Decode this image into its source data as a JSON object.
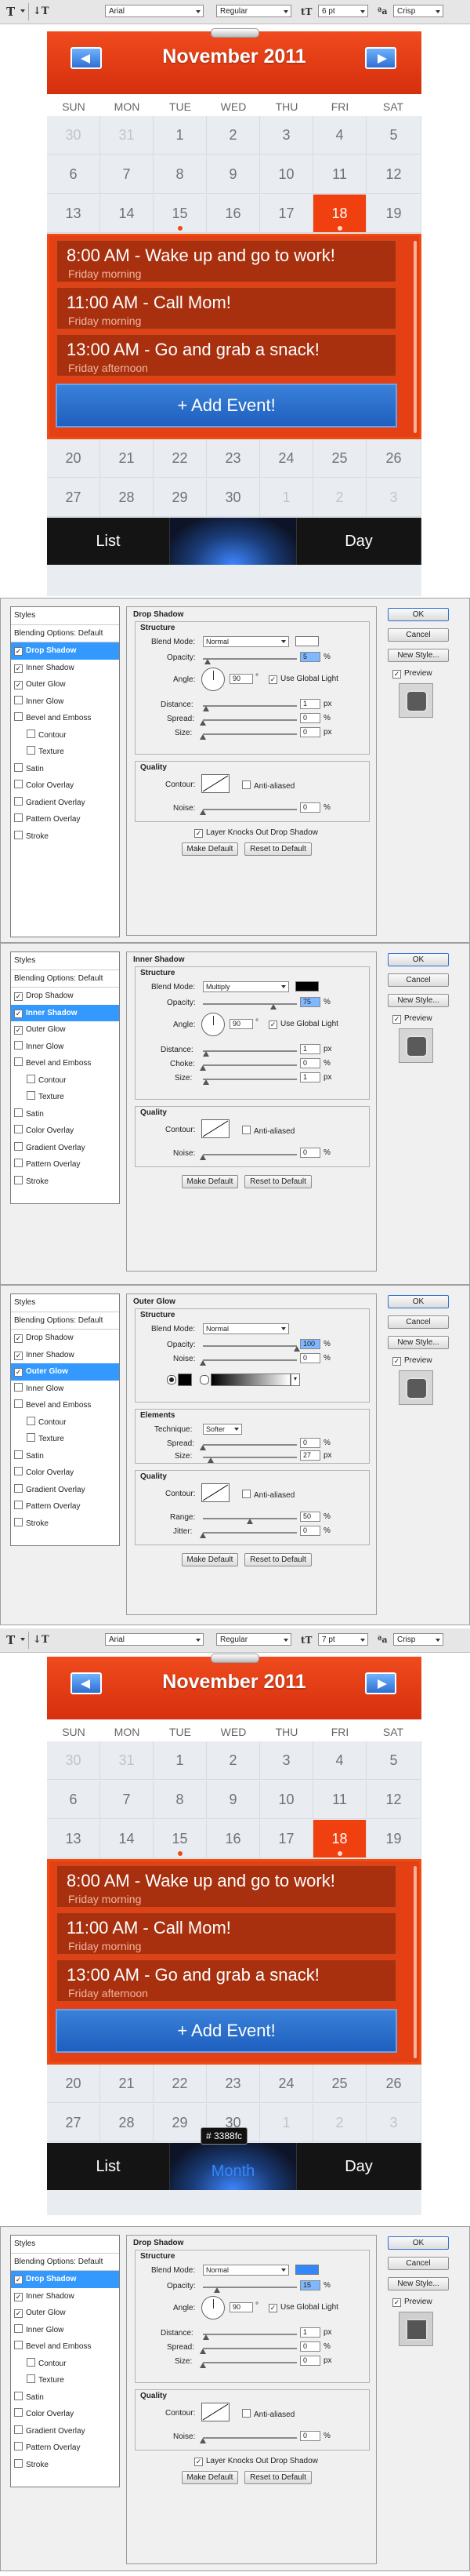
{
  "toolbars": [
    {
      "font_family": "Arial",
      "font_style": "Regular",
      "font_size": "6 pt",
      "antialias": "Crisp"
    },
    {
      "font_family": "Arial",
      "font_style": "Regular",
      "font_size": "7 pt",
      "antialias": "Crisp"
    }
  ],
  "calendar": {
    "title": "November 2011",
    "days_of_week": [
      "SUN",
      "MON",
      "TUE",
      "WED",
      "THU",
      "FRI",
      "SAT"
    ],
    "weeks_top": [
      [
        "30",
        "31",
        "1",
        "2",
        "3",
        "4",
        "5"
      ],
      [
        "6",
        "7",
        "8",
        "9",
        "10",
        "11",
        "12"
      ],
      [
        "13",
        "14",
        "15",
        "16",
        "17",
        "18",
        "19"
      ]
    ],
    "weeks_bottom": [
      [
        "20",
        "21",
        "22",
        "23",
        "24",
        "25",
        "26"
      ],
      [
        "27",
        "28",
        "29",
        "30",
        "1",
        "2",
        "3"
      ]
    ],
    "today": "18",
    "events": [
      {
        "title": "8:00 AM - Wake up and go to work!",
        "subtitle": "Friday morning"
      },
      {
        "title": "11:00 AM - Call Mom!",
        "subtitle": "Friday morning"
      },
      {
        "title": "13:00 AM - Go  and grab a snack!",
        "subtitle": "Friday afternoon"
      }
    ],
    "add_event_label": "+ Add Event!",
    "tabs": [
      "List",
      "Month",
      "Day"
    ],
    "color_tooltip": "# 3388fc"
  },
  "layer_style_dialog": {
    "styles_list": [
      {
        "label": "Styles",
        "checkbox": false,
        "header": true
      },
      {
        "label": "Blending Options: Default",
        "checkbox": false,
        "header": true
      },
      {
        "label": "Drop Shadow",
        "checkbox": true
      },
      {
        "label": "Inner Shadow",
        "checkbox": true
      },
      {
        "label": "Outer Glow",
        "checkbox": true
      },
      {
        "label": "Inner Glow",
        "checkbox": true
      },
      {
        "label": "Bevel and Emboss",
        "checkbox": true
      },
      {
        "label": "Contour",
        "checkbox": true,
        "indent": true
      },
      {
        "label": "Texture",
        "checkbox": true,
        "indent": true
      },
      {
        "label": "Satin",
        "checkbox": true
      },
      {
        "label": "Color Overlay",
        "checkbox": true
      },
      {
        "label": "Gradient Overlay",
        "checkbox": true
      },
      {
        "label": "Pattern Overlay",
        "checkbox": true
      },
      {
        "label": "Stroke",
        "checkbox": true
      }
    ],
    "buttons": {
      "ok": "OK",
      "cancel": "Cancel",
      "new_style": "New Style...",
      "preview": "Preview"
    },
    "common": {
      "structure": "Structure",
      "quality": "Quality",
      "blend_mode": "Blend Mode:",
      "opacity": "Opacity:",
      "angle": "Angle:",
      "use_global_light": "Use Global Light",
      "distance": "Distance:",
      "spread": "Spread:",
      "size": "Size:",
      "choke": "Choke:",
      "contour": "Contour:",
      "anti_aliased": "Anti-aliased",
      "noise": "Noise:",
      "make_default": "Make Default",
      "reset_to_default": "Reset to Default",
      "px": "px",
      "pct": "%",
      "deg": "°"
    },
    "drop_shadow": {
      "title": "Drop Shadow",
      "blend_mode": "Normal",
      "swatch_color": "#ffffff",
      "opacity": "5",
      "angle": "90",
      "use_global_light": true,
      "distance": "1",
      "spread": "0",
      "size": "0",
      "noise": "0",
      "knockout_label": "Layer Knocks Out Drop Shadow",
      "knockout": true
    },
    "inner_shadow": {
      "title": "Inner Shadow",
      "blend_mode": "Multiply",
      "swatch_color": "#000000",
      "opacity": "75",
      "angle": "90",
      "use_global_light": true,
      "distance": "1",
      "choke": "0",
      "size": "1",
      "noise": "0"
    },
    "outer_glow": {
      "title": "Outer Glow",
      "blend_mode": "Normal",
      "opacity": "100",
      "noise": "0",
      "elements": "Elements",
      "technique_label": "Technique:",
      "technique": "Softer",
      "spread": "0",
      "size": "27",
      "range_label": "Range:",
      "range": "50",
      "jitter_label": "Jitter:",
      "jitter": "0"
    },
    "drop_shadow_2": {
      "title": "Drop Shadow",
      "blend_mode": "Normal",
      "swatch_color": "#3388fc",
      "opacity": "15",
      "angle": "90",
      "distance": "1",
      "spread": "0",
      "size": "0",
      "noise": "0"
    }
  }
}
